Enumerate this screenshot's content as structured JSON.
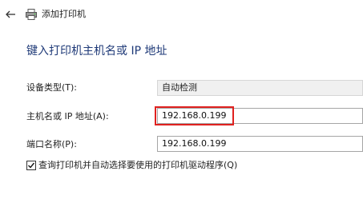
{
  "window": {
    "title": "添加打印机",
    "back_icon": "back-arrow-icon",
    "printer_icon": "printer-icon"
  },
  "heading": "键入打印机主机名或 IP 地址",
  "form": {
    "device_type": {
      "label": "设备类型(T):",
      "value": "自动检测"
    },
    "hostname": {
      "label": "主机名或 IP 地址(A):",
      "value": "192.168.0.199"
    },
    "port_name": {
      "label": "端口名称(P):",
      "value": "192.168.0.199"
    },
    "query_checkbox": {
      "label": "查询打印机并自动选择要使用的打印机驱动程序(Q)",
      "checked": true
    }
  },
  "colors": {
    "heading": "#1f3a78",
    "highlight": "#e0211f"
  }
}
